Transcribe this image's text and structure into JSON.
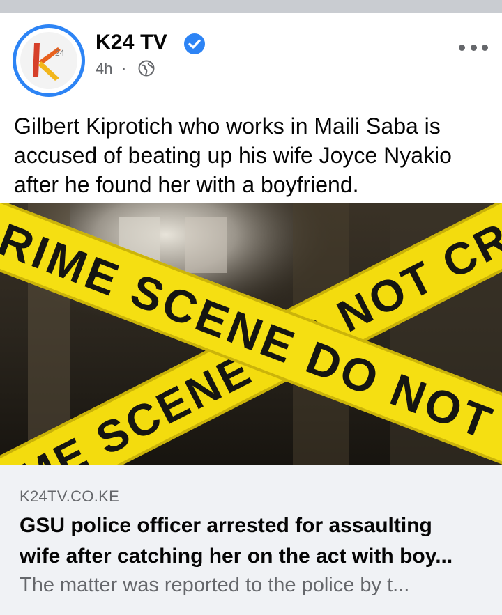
{
  "post": {
    "page_name": "K24 TV",
    "verified_icon": "verified-badge-icon",
    "time": "4h",
    "separator": "·",
    "audience_icon": "globe-icon",
    "more_icon": "more-options-icon",
    "avatar_text": "k 24",
    "text_line1": "Gilbert Kiprotich who works in Maili Saba is",
    "text_line2": "accused of beating up his wife Joyce Nyakio",
    "text_line3": "after he found her with a boyfriend."
  },
  "image": {
    "tape_upper_text": "CRIME SCENE DO NOT CR",
    "tape_lower_text": "CRIME SCENE DO NOT CR",
    "tape_color": "#f3dc0e"
  },
  "link": {
    "domain": "K24TV.CO.KE",
    "title_line1": "GSU police officer arrested for assaulting",
    "title_line2": "wife after catching her on the act with boy...",
    "description": "The matter was reported to the police by t..."
  },
  "colors": {
    "accent_blue": "#2d84f5",
    "secondary_text": "#65676b",
    "link_bg": "#f0f2f5"
  }
}
